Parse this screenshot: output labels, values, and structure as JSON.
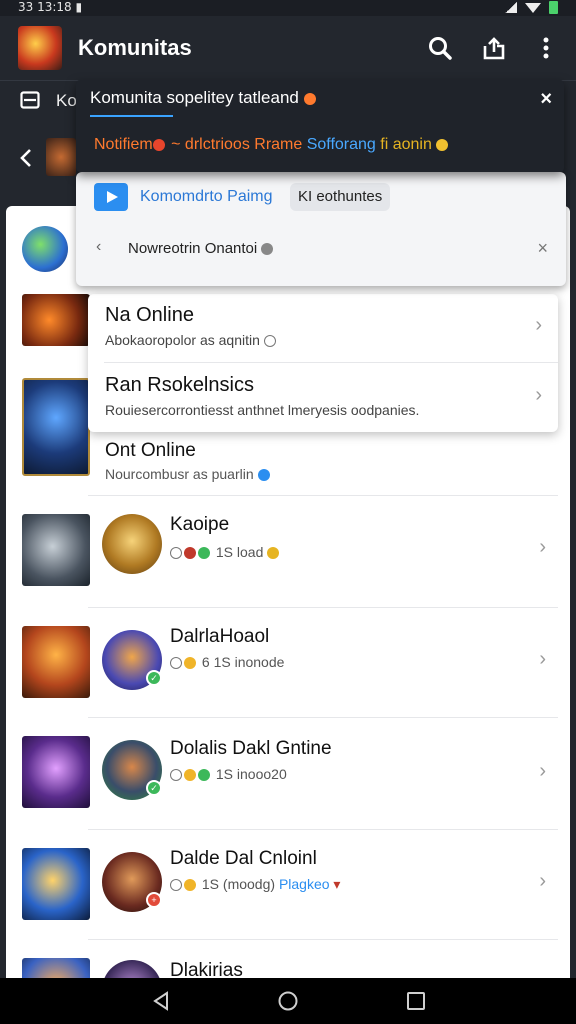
{
  "status_bar": {
    "time": "33 13:18 ▮"
  },
  "app_bar": {
    "title": "Komunitas",
    "icons": [
      "search-icon",
      "share-icon",
      "more-vert-icon"
    ]
  },
  "sub_bar": {
    "text": "Ko"
  },
  "popup": {
    "title": "Komunita sopelitey tatleand",
    "notification_part1": "Notifiem",
    "notification_part2": " ~ ",
    "notification_part3": "drlctrioos Rrame ",
    "notification_part4": "Sofforang",
    "notification_part5": " fi aonin",
    "close": "×"
  },
  "card": {
    "title": "Komomdrto Paimg",
    "chip": "KI eothuntes",
    "subtitle": "Nowreotrin Onantoi",
    "close": "×"
  },
  "menu": {
    "items": [
      {
        "title": "Na Online",
        "subtitle": "Abokaoropolor as aqnitin"
      },
      {
        "title": "Ran Rsokelnsics",
        "subtitle": "Rouiesercorrontiesst anthnet lmeryesis oodpanies."
      }
    ]
  },
  "list": {
    "items": [
      {
        "name": "Ont Online",
        "meta": "Nourcombusr as puarlin"
      },
      {
        "name": "Kaoipe",
        "meta": "1S load"
      },
      {
        "name": "DalrlaHoaol",
        "meta": "6 1S inonode"
      },
      {
        "name": "Dolalis Dakl Gntine",
        "meta": "1S inooo20"
      },
      {
        "name": "Dalde Dal Cnloinl",
        "meta": "1S (moodg)",
        "tag": "Plagkeo"
      },
      {
        "name": "Dlakirias",
        "meta": ""
      }
    ]
  },
  "colors": {
    "app_bar_bg": "#23272e",
    "accent_blue": "#2b8ef0",
    "online_green": "#3cb85a",
    "notif_orange": "#ff7a2e"
  }
}
